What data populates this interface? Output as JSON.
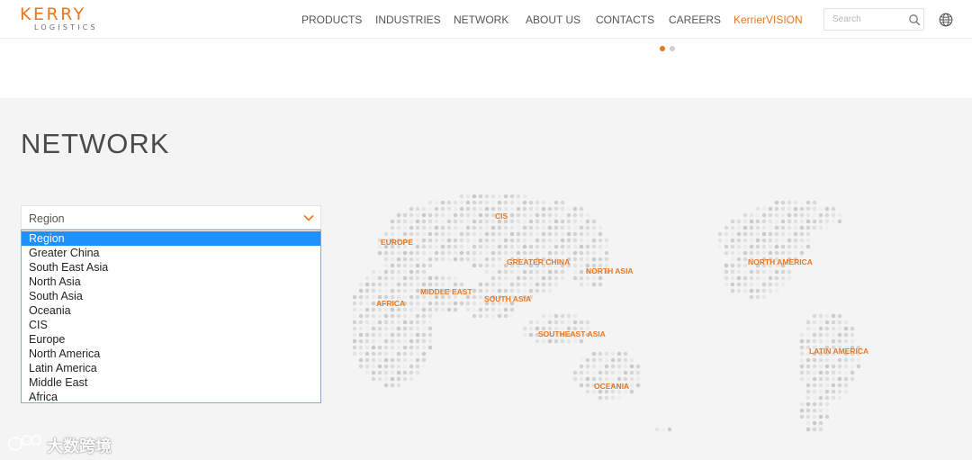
{
  "brand": {
    "name": "KERRY",
    "sub": "LOGISTICS",
    "color": "#e87722"
  },
  "nav": {
    "items": [
      {
        "label": "PRODUCTS"
      },
      {
        "label": "INDUSTRIES"
      },
      {
        "label": "NETWORK"
      },
      {
        "label": "ABOUT US"
      },
      {
        "label": "CONTACTS"
      },
      {
        "label": "CAREERS"
      },
      {
        "label": "KerrierVISION",
        "accent": true
      }
    ]
  },
  "search": {
    "placeholder": "Search",
    "icon": "search-icon"
  },
  "language_icon": "globe-icon",
  "carousel": {
    "active_index": 0,
    "count": 2
  },
  "network": {
    "title": "NETWORK",
    "select": {
      "value": "Region",
      "options": [
        "Region",
        "Greater China",
        "South East Asia",
        "North Asia",
        "South Asia",
        "Oceania",
        "CIS",
        "Europe",
        "North America",
        "Latin America",
        "Middle East",
        "Africa"
      ],
      "selected_index": 0
    },
    "map_labels": {
      "cis": "CIS",
      "europe": "EUROPE",
      "greater_china": "GREATER CHINA",
      "north_asia": "NORTH ASIA",
      "middle_east": "MIDDLE EAST",
      "south_asia": "SOUTH ASIA",
      "africa": "AFRICA",
      "southeast_asia": "SOUTHEAST ASIA",
      "oceania": "OCEANIA",
      "north_america": "NORTH AMERICA",
      "latin_america": "LATIN AMERICA"
    }
  },
  "watermark": {
    "text": "大数跨境"
  },
  "colors": {
    "accent": "#e87722",
    "section_bg": "#f4f4f4",
    "selected_option": "#1e90ff",
    "map_dots": "#d6d6d6"
  }
}
